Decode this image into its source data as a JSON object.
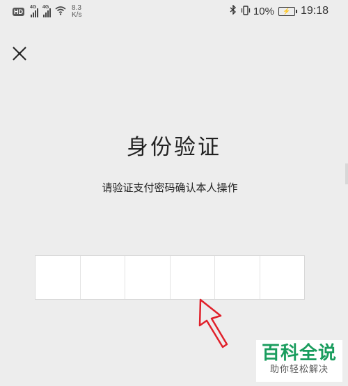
{
  "status_bar": {
    "hd_badge": "HD",
    "signal1_label": "4G",
    "signal2_label": "4G",
    "net_speed_value": "8.3",
    "net_speed_unit": "K/s",
    "battery_percent": "10%",
    "time": "19:18"
  },
  "header": {
    "close_icon": "close-icon"
  },
  "main": {
    "title": "身份验证",
    "subtitle": "请验证支付密码确认本人操作",
    "pin_cells": 6
  },
  "watermark": {
    "title": "百科全说",
    "subtitle": "助你轻松解决"
  },
  "colors": {
    "background": "#ededed",
    "arrow": "#e0202a",
    "watermark_green": "#1a9d5e"
  }
}
